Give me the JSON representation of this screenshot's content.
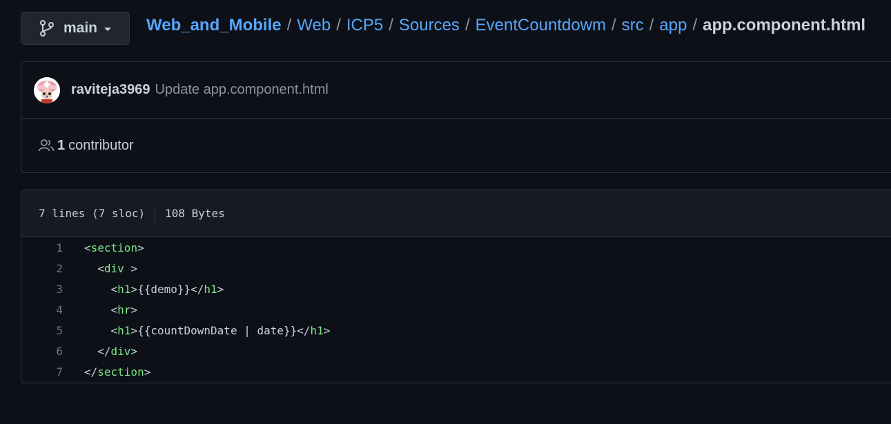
{
  "branch": {
    "label": "main"
  },
  "breadcrumb": {
    "items": [
      "Web_and_Mobile",
      "Web",
      "ICP5",
      "Sources",
      "EventCountdowm",
      "src",
      "app"
    ],
    "separator": "/",
    "current": "app.component.html"
  },
  "commit": {
    "author": "raviteja3969",
    "message": "Update app.component.html"
  },
  "contributors": {
    "count": "1",
    "label": "contributor"
  },
  "file": {
    "lines_info": "7 lines (7 sloc)",
    "size": "108 Bytes"
  },
  "code_lines": [
    {
      "n": "1",
      "indent": "",
      "open": "<",
      "tag": "section",
      "mid": "",
      "close": ">",
      "rest": []
    },
    {
      "n": "2",
      "indent": "  ",
      "open": "<",
      "tag": "div",
      "mid": " ",
      "close": ">",
      "rest": []
    },
    {
      "n": "3",
      "indent": "    ",
      "open": "<",
      "tag": "h1",
      "mid": "",
      "close": ">",
      "rest": [
        "{{demo}}",
        "</",
        "h1",
        ">"
      ]
    },
    {
      "n": "4",
      "indent": "    ",
      "open": "<",
      "tag": "hr",
      "mid": "",
      "close": ">",
      "rest": []
    },
    {
      "n": "5",
      "indent": "    ",
      "open": "<",
      "tag": "h1",
      "mid": "",
      "close": ">",
      "rest": [
        "{{countDownDate | date}}",
        "</",
        "h1",
        ">"
      ]
    },
    {
      "n": "6",
      "indent": "  ",
      "open": "</",
      "tag": "div",
      "mid": "",
      "close": ">",
      "rest": []
    },
    {
      "n": "7",
      "indent": "",
      "open": "</",
      "tag": "section",
      "mid": "",
      "close": ">",
      "rest": []
    }
  ],
  "colors": {
    "background": "#0d1117",
    "link": "#58a6ff",
    "tag": "#7ee787",
    "muted": "#8b949e",
    "border": "#30363d"
  },
  "icons": {
    "branch": "git-branch-icon",
    "caret": "caret-down-icon",
    "contributors": "people-icon",
    "avatar": "user-avatar"
  }
}
